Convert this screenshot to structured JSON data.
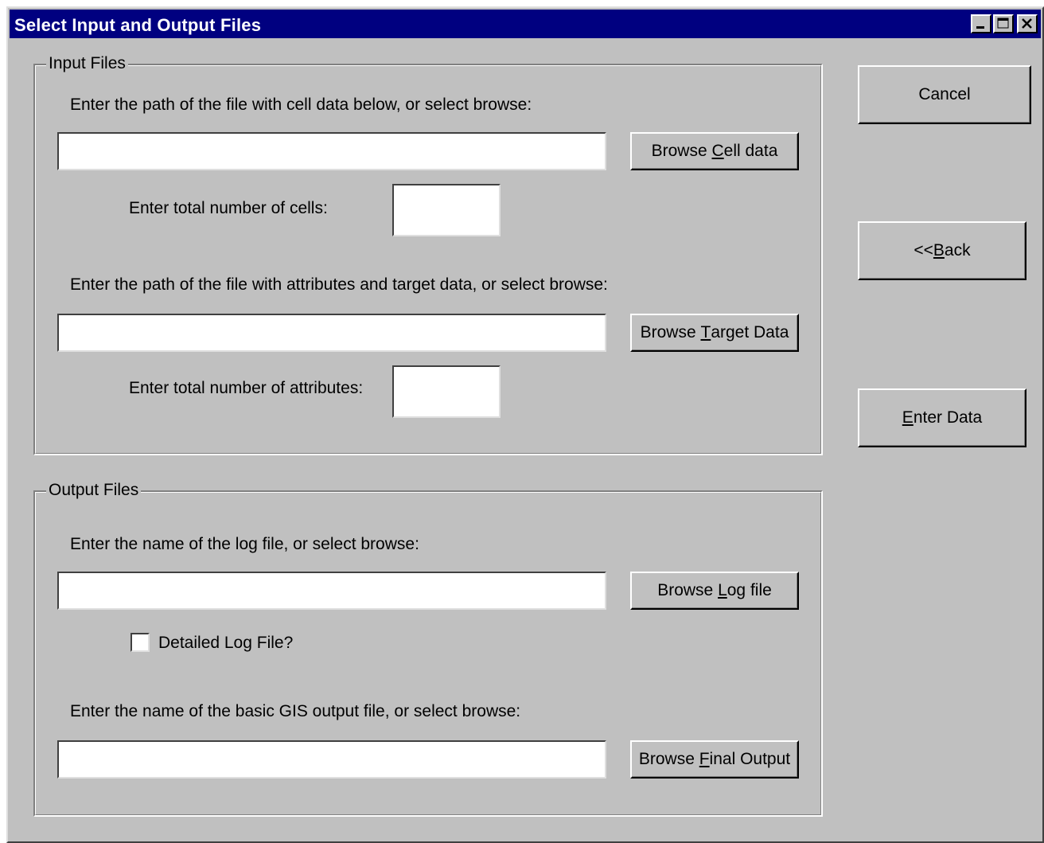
{
  "window": {
    "title": "Select Input and Output Files"
  },
  "input_group": {
    "legend": "Input Files",
    "cell_path_label": "Enter the path of the file with cell data below, or select browse:",
    "cell_path_value": "",
    "browse_cell": {
      "pre": "Browse ",
      "acc": "C",
      "post": "ell data"
    },
    "cell_count_label": "Enter total number of cells:",
    "cell_count_value": "",
    "target_path_label": "Enter the path of the file with attributes and target data, or select browse:",
    "target_path_value": "",
    "browse_target": {
      "pre": "Browse ",
      "acc": "T",
      "post": "arget Data"
    },
    "attr_count_label": "Enter total number of attributes:",
    "attr_count_value": ""
  },
  "output_group": {
    "legend": "Output Files",
    "log_label": "Enter the name of the log file, or select browse:",
    "log_value": "",
    "browse_log": {
      "pre": "Browse ",
      "acc": "L",
      "post": "og file"
    },
    "detailed_log_label": "Detailed Log File?",
    "detailed_log_checked": false,
    "gis_label": "Enter the name of the basic GIS output file, or select browse:",
    "gis_value": "",
    "browse_final": {
      "pre": "Browse ",
      "acc": "F",
      "post": "inal Output"
    }
  },
  "side_buttons": {
    "cancel": {
      "pre": "Cancel",
      "acc": "",
      "post": ""
    },
    "back": {
      "pre": "<<",
      "acc": "B",
      "post": "ack"
    },
    "enter": {
      "pre": "",
      "acc": "E",
      "post": "nter Data"
    }
  },
  "colors": {
    "title_bar": "#000080",
    "face": "#c0c0c0"
  }
}
